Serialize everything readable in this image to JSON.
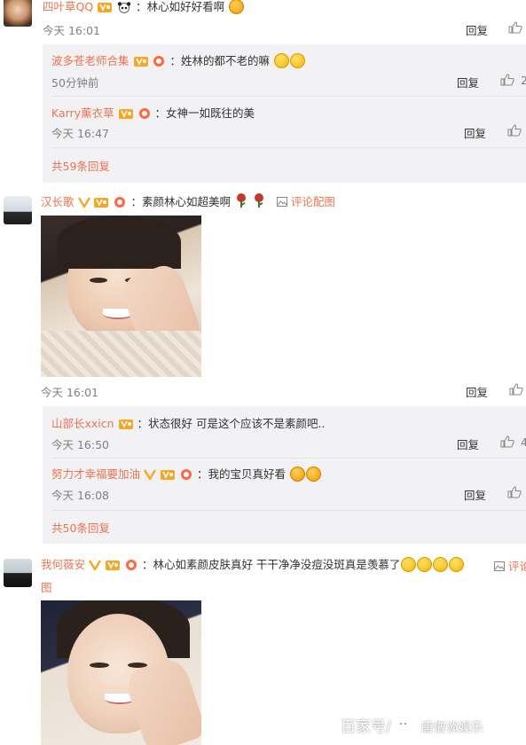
{
  "comments": [
    {
      "user": "四叶草QQ",
      "text": "：林心如好好看啊",
      "time": "今天 16:01",
      "reply_label": "回复",
      "replies": [
        {
          "user": "波多苍老师合集",
          "text": "：姓林的都不老的嘛",
          "time": "50分钟前",
          "reply_label": "回复"
        },
        {
          "user": "Karry薰衣草",
          "text": "：女神一如既往的美",
          "time": "今天 16:47",
          "reply_label": "回复"
        }
      ],
      "total_replies": "共59条回复"
    },
    {
      "user": "汉长歌",
      "text": "：素颜林心如超美啊",
      "pic_comment": "评论配图",
      "time": "今天 16:01",
      "reply_label": "回复",
      "replies": [
        {
          "user": "山部长xxicn",
          "text": "：状态很好 可是这个应该不是素颜吧..",
          "time": "今天 16:50",
          "reply_label": "回复"
        },
        {
          "user": "努力才幸福要加油",
          "text": "：我的宝贝真好看",
          "time": "今天 16:08",
          "reply_label": "回复"
        }
      ],
      "total_replies": "共50条回复"
    },
    {
      "user": "我何薇安",
      "text": "：林心如素颜皮肤真好 干干净净没痘没斑真是羡慕了",
      "pic_comment_part1": "评论",
      "pic_comment_part2": "图"
    }
  ],
  "watermark": {
    "left": "百家号/",
    "right": "唐僧谈娱乐"
  },
  "colors": {
    "username": "#eb7350",
    "reply_bg": "#f2f2f5",
    "time": "#808080"
  }
}
